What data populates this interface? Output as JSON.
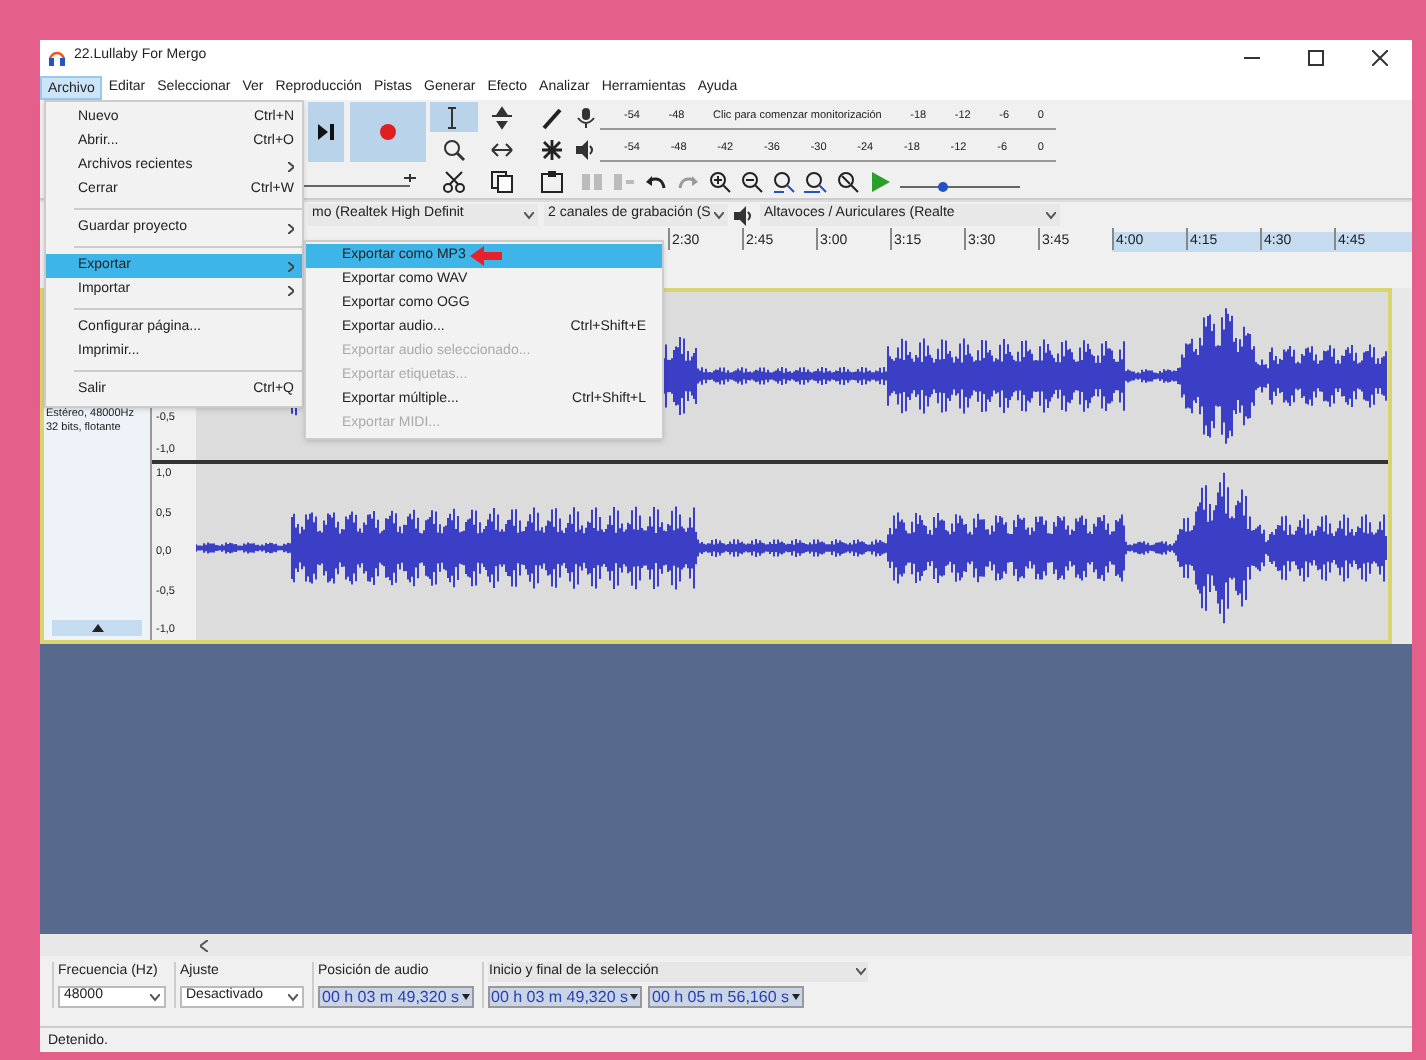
{
  "window": {
    "title": "22.Lullaby For Mergo"
  },
  "menu_bar": [
    {
      "label": "Archivo",
      "selected": true
    },
    {
      "label": "Editar",
      "selected": false
    },
    {
      "label": "Seleccionar",
      "selected": false
    },
    {
      "label": "Ver",
      "selected": false
    },
    {
      "label": "Reproducción",
      "selected": false
    },
    {
      "label": "Pistas",
      "selected": false
    },
    {
      "label": "Generar",
      "selected": false
    },
    {
      "label": "Efecto",
      "selected": false
    },
    {
      "label": "Analizar",
      "selected": false
    },
    {
      "label": "Herramientas",
      "selected": false
    },
    {
      "label": "Ayuda",
      "selected": false
    }
  ],
  "file_menu": [
    {
      "kind": "item",
      "label": "Nuevo",
      "shortcut": "Ctrl+N",
      "submenu": false,
      "selected": false
    },
    {
      "kind": "item",
      "label": "Abrir...",
      "shortcut": "Ctrl+O",
      "submenu": false,
      "selected": false
    },
    {
      "kind": "item",
      "label": "Archivos recientes",
      "submenu": true,
      "selected": false
    },
    {
      "kind": "item",
      "label": "Cerrar",
      "shortcut": "Ctrl+W",
      "submenu": false,
      "selected": false
    },
    {
      "kind": "separator"
    },
    {
      "kind": "item",
      "label": "Guardar proyecto",
      "submenu": true,
      "selected": false
    },
    {
      "kind": "separator"
    },
    {
      "kind": "item",
      "label": "Exportar",
      "submenu": true,
      "selected": true
    },
    {
      "kind": "item",
      "label": "Importar",
      "submenu": true,
      "selected": false
    },
    {
      "kind": "separator"
    },
    {
      "kind": "item",
      "label": "Configurar página...",
      "submenu": false,
      "selected": false
    },
    {
      "kind": "item",
      "label": "Imprimir...",
      "submenu": false,
      "selected": false
    },
    {
      "kind": "separator"
    },
    {
      "kind": "item",
      "label": "Salir",
      "shortcut": "Ctrl+Q",
      "submenu": false,
      "selected": false
    }
  ],
  "export_submenu": [
    {
      "label": "Exportar como MP3",
      "disabled": false,
      "selected": true,
      "pointer_arrow": true
    },
    {
      "label": "Exportar como WAV",
      "disabled": false,
      "selected": false,
      "pointer_arrow": false
    },
    {
      "label": "Exportar como OGG",
      "disabled": false,
      "selected": false,
      "pointer_arrow": false
    },
    {
      "label": "Exportar audio...",
      "shortcut": "Ctrl+Shift+E",
      "disabled": false,
      "selected": false,
      "pointer_arrow": false
    },
    {
      "label": "Exportar audio seleccionado...",
      "disabled": true,
      "selected": false,
      "pointer_arrow": false
    },
    {
      "label": "Exportar etiquetas...",
      "disabled": true,
      "selected": false,
      "pointer_arrow": false
    },
    {
      "label": "Exportar múltiple...",
      "shortcut": "Ctrl+Shift+L",
      "disabled": false,
      "selected": false,
      "pointer_arrow": false
    },
    {
      "label": "Exportar MIDI...",
      "disabled": true,
      "selected": false,
      "pointer_arrow": false
    }
  ],
  "speed_slider": {
    "level": 0.35
  },
  "recording_meter": [
    "-54",
    "-48",
    "Clic para comenzar monitorización",
    "-18",
    "-12",
    "-6",
    "0"
  ],
  "playback_meter": [
    "-54",
    "-48",
    "-42",
    "-36",
    "-30",
    "-24",
    "-18",
    "-12",
    "-6",
    "0"
  ],
  "devices": {
    "recording_device": "mo (Realtek High Definit",
    "channels": "2 canales de grabación (S",
    "playback_device": "Altavoces / Auriculares (Realte"
  },
  "ruler": [
    "2:30",
    "2:45",
    "3:00",
    "3:15",
    "3:30",
    "3:45",
    "4:00",
    "4:15",
    "4:30",
    "4:45"
  ],
  "track": {
    "info": [
      "Estéreo, 48000Hz",
      "32 bits, flotante"
    ],
    "channel_1_scale": [
      "-0,5",
      "-1,0"
    ],
    "channel_2_scale": [
      "1,0",
      "0,5",
      "0,0",
      "-0,5",
      "-1,0"
    ]
  },
  "selection_toolbar": {
    "rate_label": "Frecuencia (Hz)",
    "rate": "48000",
    "snap_label": "Ajuste",
    "snap": "Desactivado",
    "position_label": "Posición de audio",
    "position": "00 h 03 m 49,320 s",
    "selection_label": "Inicio y final de la selección",
    "selection_start": "00 h 03 m 49,320 s",
    "selection_end": "00 h 05 m 56,160 s"
  },
  "status_bar": "Detenido."
}
